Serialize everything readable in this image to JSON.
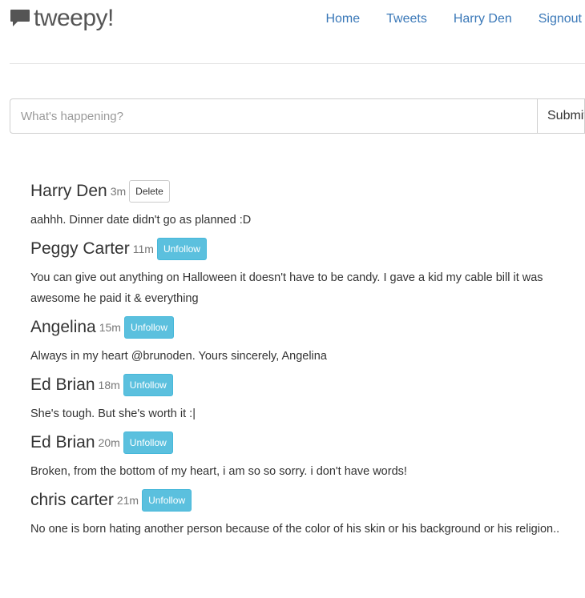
{
  "brand": {
    "name": "tweepy!",
    "icon": "speech-bubble-icon"
  },
  "nav": [
    {
      "label": "Home"
    },
    {
      "label": "Tweets"
    },
    {
      "label": "Harry Den"
    },
    {
      "label": "Signout"
    }
  ],
  "compose": {
    "placeholder": "What's happening?",
    "value": "",
    "submit_label": "Submit"
  },
  "tweets": [
    {
      "author": "Harry Den",
      "time": "3m",
      "action": "Delete",
      "text": "aahhh. Dinner date didn't go as planned :D"
    },
    {
      "author": "Peggy Carter",
      "time": "11m",
      "action": "Unfollow",
      "text": "You can give out anything on Halloween it doesn't have to be candy. I gave a kid my cable bill it was awesome he paid it & everything"
    },
    {
      "author": "Angelina",
      "time": "15m",
      "action": "Unfollow",
      "text": "Always in my heart @brunoden. Yours sincerely, Angelina"
    },
    {
      "author": "Ed Brian",
      "time": "18m",
      "action": "Unfollow",
      "text": "She's tough. But she's worth it :|"
    },
    {
      "author": "Ed Brian",
      "time": "20m",
      "action": "Unfollow",
      "text": "Broken, from the bottom of my heart, i am so so sorry. i don't have words!"
    },
    {
      "author": "chris carter",
      "time": "21m",
      "action": "Unfollow",
      "text": "No one is born hating another person because of the color of his skin or his background or his religion.."
    }
  ],
  "colors": {
    "link": "#3a78b8",
    "info_button": "#5bc0de"
  }
}
